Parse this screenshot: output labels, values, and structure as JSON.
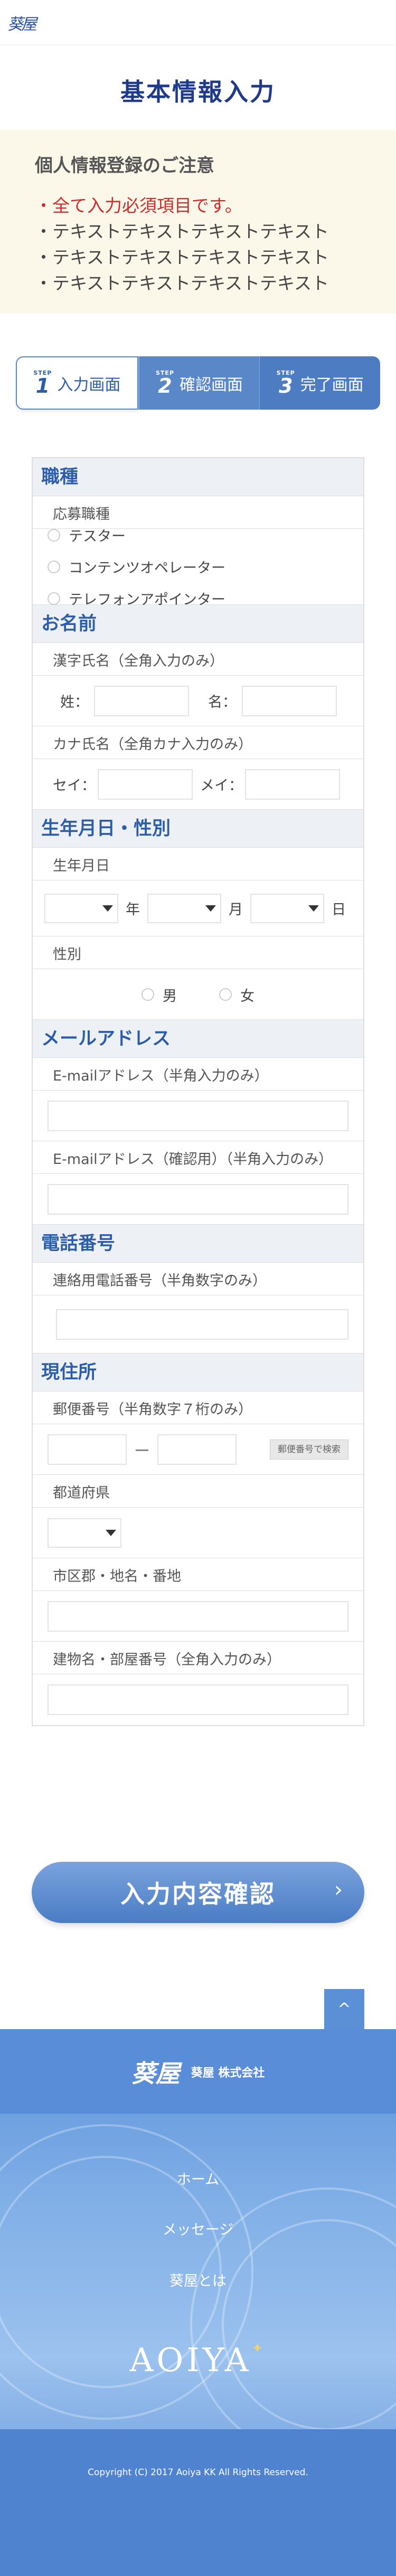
{
  "header": {
    "logo_text": "葵屋"
  },
  "page": {
    "title": "基本情報入力"
  },
  "notice": {
    "title": "個人情報登録のご注意",
    "required_line": "・全て入力必須項目です。",
    "lines": [
      "・テキストテキストテキストテキスト",
      "・テキストテキストテキストテキスト",
      "・テキストテキストテキストテキスト"
    ]
  },
  "steps": [
    {
      "word": "STEP",
      "num": "1",
      "label": "入力画面",
      "state": "active"
    },
    {
      "word": "STEP",
      "num": "2",
      "label": "確認画面",
      "state": "inactive"
    },
    {
      "word": "STEP",
      "num": "3",
      "label": "完了画面",
      "state": "inactive"
    }
  ],
  "form": {
    "job": {
      "heading": "職種",
      "sublabel": "応募職種",
      "options": [
        "テスター",
        "コンテンツオペレーター",
        "テレフォンアポインター"
      ]
    },
    "name": {
      "heading": "お名前",
      "kanji_label": "漢字氏名（全角入力のみ）",
      "last_label": "姓：",
      "first_label": "名：",
      "kana_label": "カナ氏名（全角カナ入力のみ）",
      "last_kana_label": "セイ：",
      "first_kana_label": "メイ："
    },
    "birth": {
      "heading": "生年月日・性別",
      "birth_label": "生年月日",
      "year_unit": "年",
      "month_unit": "月",
      "day_unit": "日",
      "gender_label": "性別",
      "gender_options": [
        "男",
        "女"
      ]
    },
    "email": {
      "heading": "メールアドレス",
      "email_label": "E-mailアドレス（半角入力のみ）",
      "confirm_label": "E-mailアドレス（確認用）（半角入力のみ）"
    },
    "phone": {
      "heading": "電話番号",
      "phone_label": "連絡用電話番号（半角数字のみ）"
    },
    "address": {
      "heading": "現住所",
      "zip_label": "郵便番号（半角数字７桁のみ）",
      "zip_dash": "ー",
      "zip_search": "郵便番号で検索",
      "pref_label": "都道府県",
      "city_label": "市区郡・地名・番地",
      "building_label": "建物名・部屋番号（全角入力のみ）"
    }
  },
  "confirm_button": {
    "label": "入力内容確認",
    "chevron": "›"
  },
  "pagetop": {
    "icon": "^"
  },
  "footer": {
    "logo_text": "葵屋",
    "company": "葵屋 株式会社",
    "nav": [
      "ホーム",
      "メッセージ",
      "葵屋とは"
    ],
    "brand_mark": "AOIYA",
    "copyright": "Copyright (C) 2017 Aoiya KK All Rights Reserved."
  },
  "colors": {
    "accent": "#2c5da9",
    "title": "#1f3a8a",
    "required": "#d02b2b",
    "footer": "#5a8dd7"
  }
}
